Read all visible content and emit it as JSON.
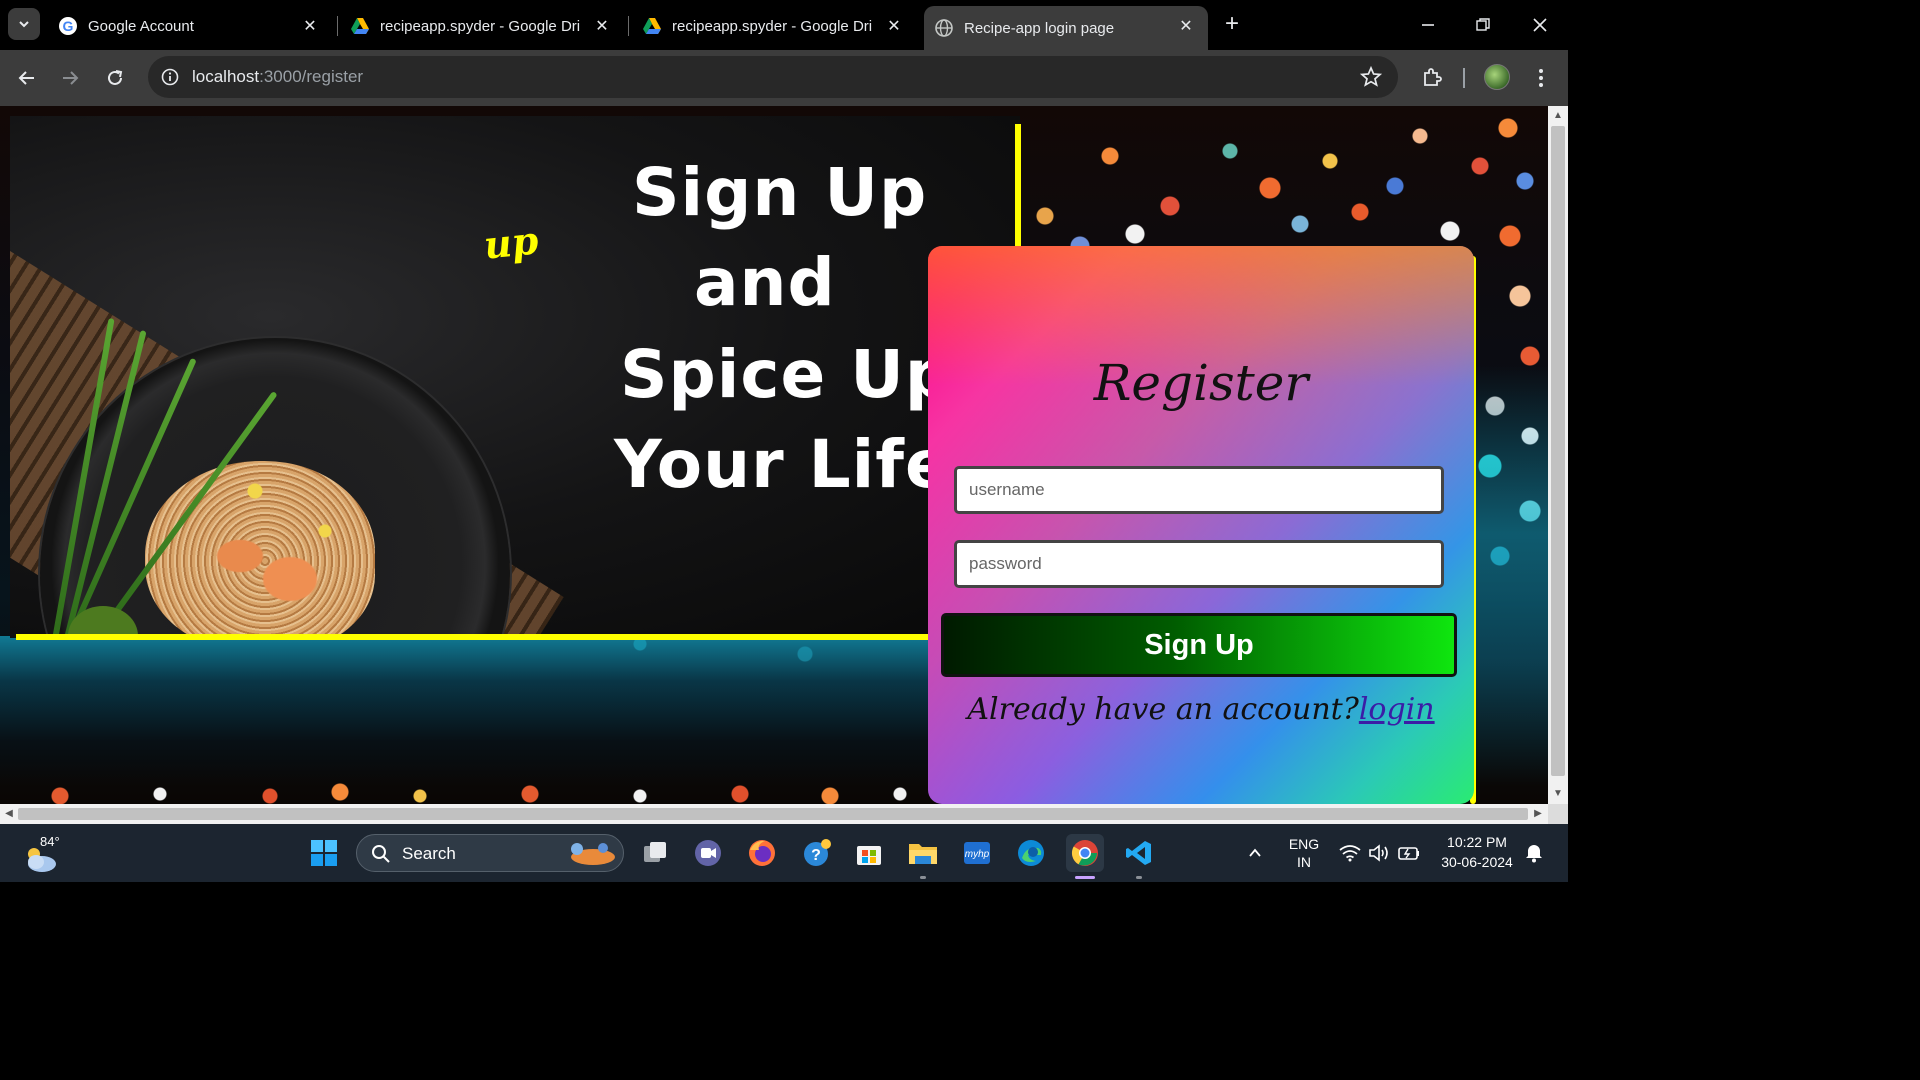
{
  "browser": {
    "tabs": [
      {
        "title": "Google Account",
        "favicon": "google-g-icon"
      },
      {
        "title": "recipeapp.spyder - Google Drive",
        "favicon": "google-drive-icon"
      },
      {
        "title": "recipeapp.spyder - Google Drive",
        "favicon": "google-drive-icon"
      },
      {
        "title": "Recipe-app login page",
        "favicon": "globe-icon",
        "active": true
      }
    ],
    "url_host": "localhost",
    "url_rest": ":3000/register"
  },
  "page": {
    "hero_tag": "up",
    "hero_lines": [
      "Sign Up",
      "and",
      "Spice Up",
      "Your Life!"
    ],
    "register": {
      "title": "Register",
      "username_placeholder": "username",
      "password_placeholder": "password",
      "submit_label": "Sign Up",
      "already_text": "Already have an account?",
      "login_link": "login"
    }
  },
  "taskbar": {
    "weather_temp": "84°",
    "search_label": "Search",
    "lang_line1": "ENG",
    "lang_line2": "IN",
    "time": "10:22 PM",
    "date": "30-06-2024"
  },
  "colors": {
    "accent_yellow": "#ffff00",
    "signup_green": "#0fe60f",
    "card_pink": "#ff0080",
    "card_green": "#1ef078"
  }
}
